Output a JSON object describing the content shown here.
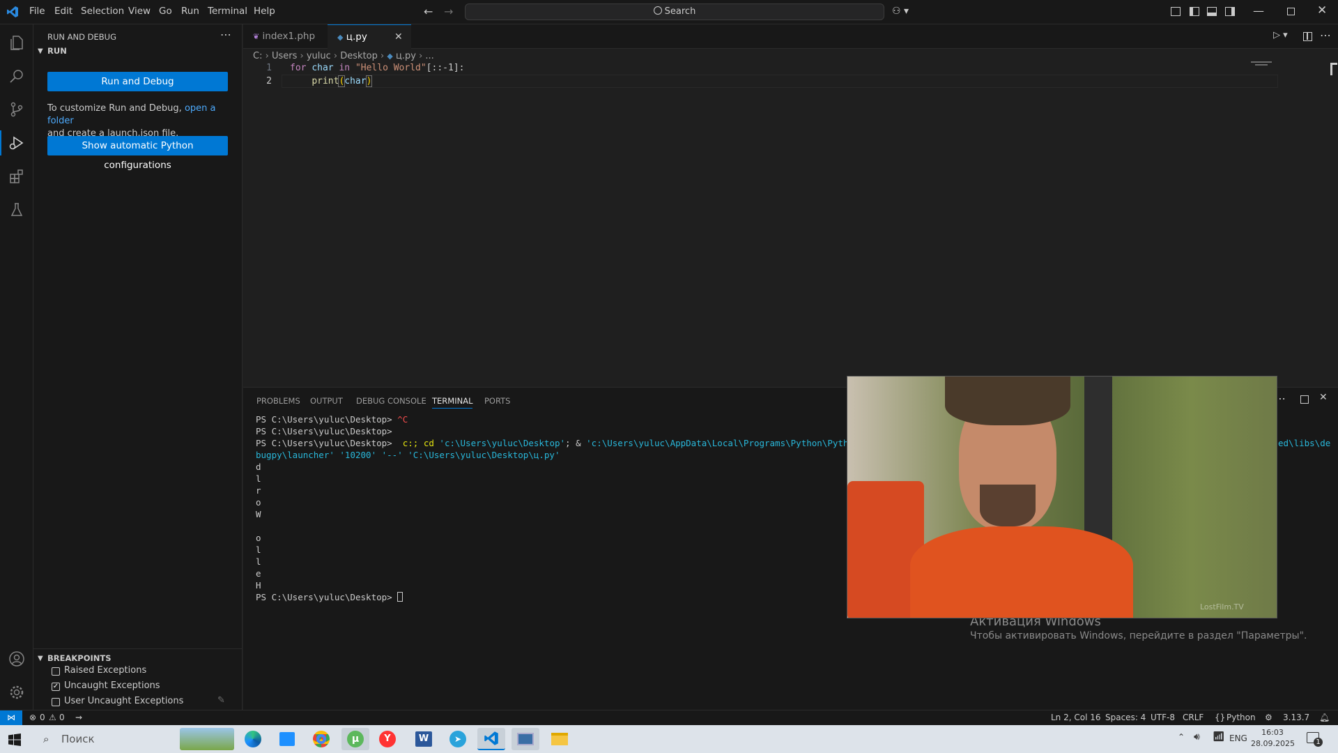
{
  "menu": [
    "File",
    "Edit",
    "Selection",
    "View",
    "Go",
    "Run",
    "Terminal",
    "Help"
  ],
  "search": {
    "label": "Search"
  },
  "sidebar": {
    "title": "RUN AND DEBUG",
    "section": "RUN",
    "run_button": "Run and Debug",
    "info_prefix": "To customize Run and Debug, ",
    "info_link": "open a folder",
    "info_suffix": "and create a launch.json file.",
    "python_button": "Show automatic Python configurations",
    "breakpoints": {
      "title": "BREAKPOINTS",
      "items": [
        {
          "label": "Raised Exceptions",
          "checked": false
        },
        {
          "label": "Uncaught Exceptions",
          "checked": true
        },
        {
          "label": "User Uncaught Exceptions",
          "checked": false
        }
      ]
    }
  },
  "tabs": [
    {
      "label": "index1.php",
      "active": false
    },
    {
      "label": "ц.py",
      "active": true
    }
  ],
  "breadcrumb": [
    "C:",
    "Users",
    "yuluc",
    "Desktop",
    "ц.py",
    "..."
  ],
  "code": {
    "line_numbers": [
      "1",
      "2"
    ],
    "line1": {
      "kw1": "for",
      "var": "char",
      "kw2": "in",
      "str": "\"Hello World\"",
      "rest": "[::-1]:"
    },
    "line2": {
      "fn": "print",
      "open": "(",
      "var": "char",
      "close": ")"
    }
  },
  "panel": {
    "tabs": [
      "PROBLEMS",
      "OUTPUT",
      "DEBUG CONSOLE",
      "TERMINAL",
      "PORTS"
    ],
    "active_tab": "TERMINAL",
    "terminal": {
      "line1_prompt": "PS C:\\Users\\yuluc\\Desktop> ",
      "line1_cmd": "^C",
      "line2": "PS C:\\Users\\yuluc\\Desktop>",
      "line3_prompt": "PS C:\\Users\\yuluc\\Desktop> ",
      "line3_cmd_a": " c:; cd ",
      "line3_path1": "'c:\\Users\\yuluc\\Desktop'",
      "line3_cmd_b": "; & ",
      "line3_path2": "'c:\\Users\\yuluc\\AppData\\Local\\Programs\\Python\\Python313\\py",
      "line3_tail": "ed\\libs\\de",
      "line4": "bugpy\\launcher' '10200' '--' 'C:\\Users\\yuluc\\Desktop\\ц.py'",
      "output": [
        "d",
        "l",
        "r",
        "o",
        "W",
        "",
        "o",
        "l",
        "l",
        "e",
        "H"
      ],
      "last_prompt": "PS C:\\Users\\yuluc\\Desktop> "
    }
  },
  "video_overlay": {
    "watermark": "LostFilm.TV"
  },
  "activation": {
    "title": "Активация Windows",
    "subtitle": "Чтобы активировать Windows, перейдите в раздел \"Параметры\"."
  },
  "status": {
    "errors": "0",
    "warnings": "0",
    "position": "Ln 2, Col 16",
    "spaces": "Spaces: 4",
    "encoding": "UTF-8",
    "eol": "CRLF",
    "language": "Python",
    "python_version": "3.13.7"
  },
  "taskbar": {
    "search_placeholder": "Поиск",
    "lang": "ENG",
    "time": "16:03",
    "date": "28.09.2025",
    "notifications": "1"
  },
  "colors": {
    "accent": "#0078d4",
    "keyword": "#c586c0",
    "keyword_blue": "#569cd6",
    "variable": "#9cdcfe",
    "string": "#ce9178",
    "function": "#dcdcaa",
    "link": "#4daafc"
  }
}
